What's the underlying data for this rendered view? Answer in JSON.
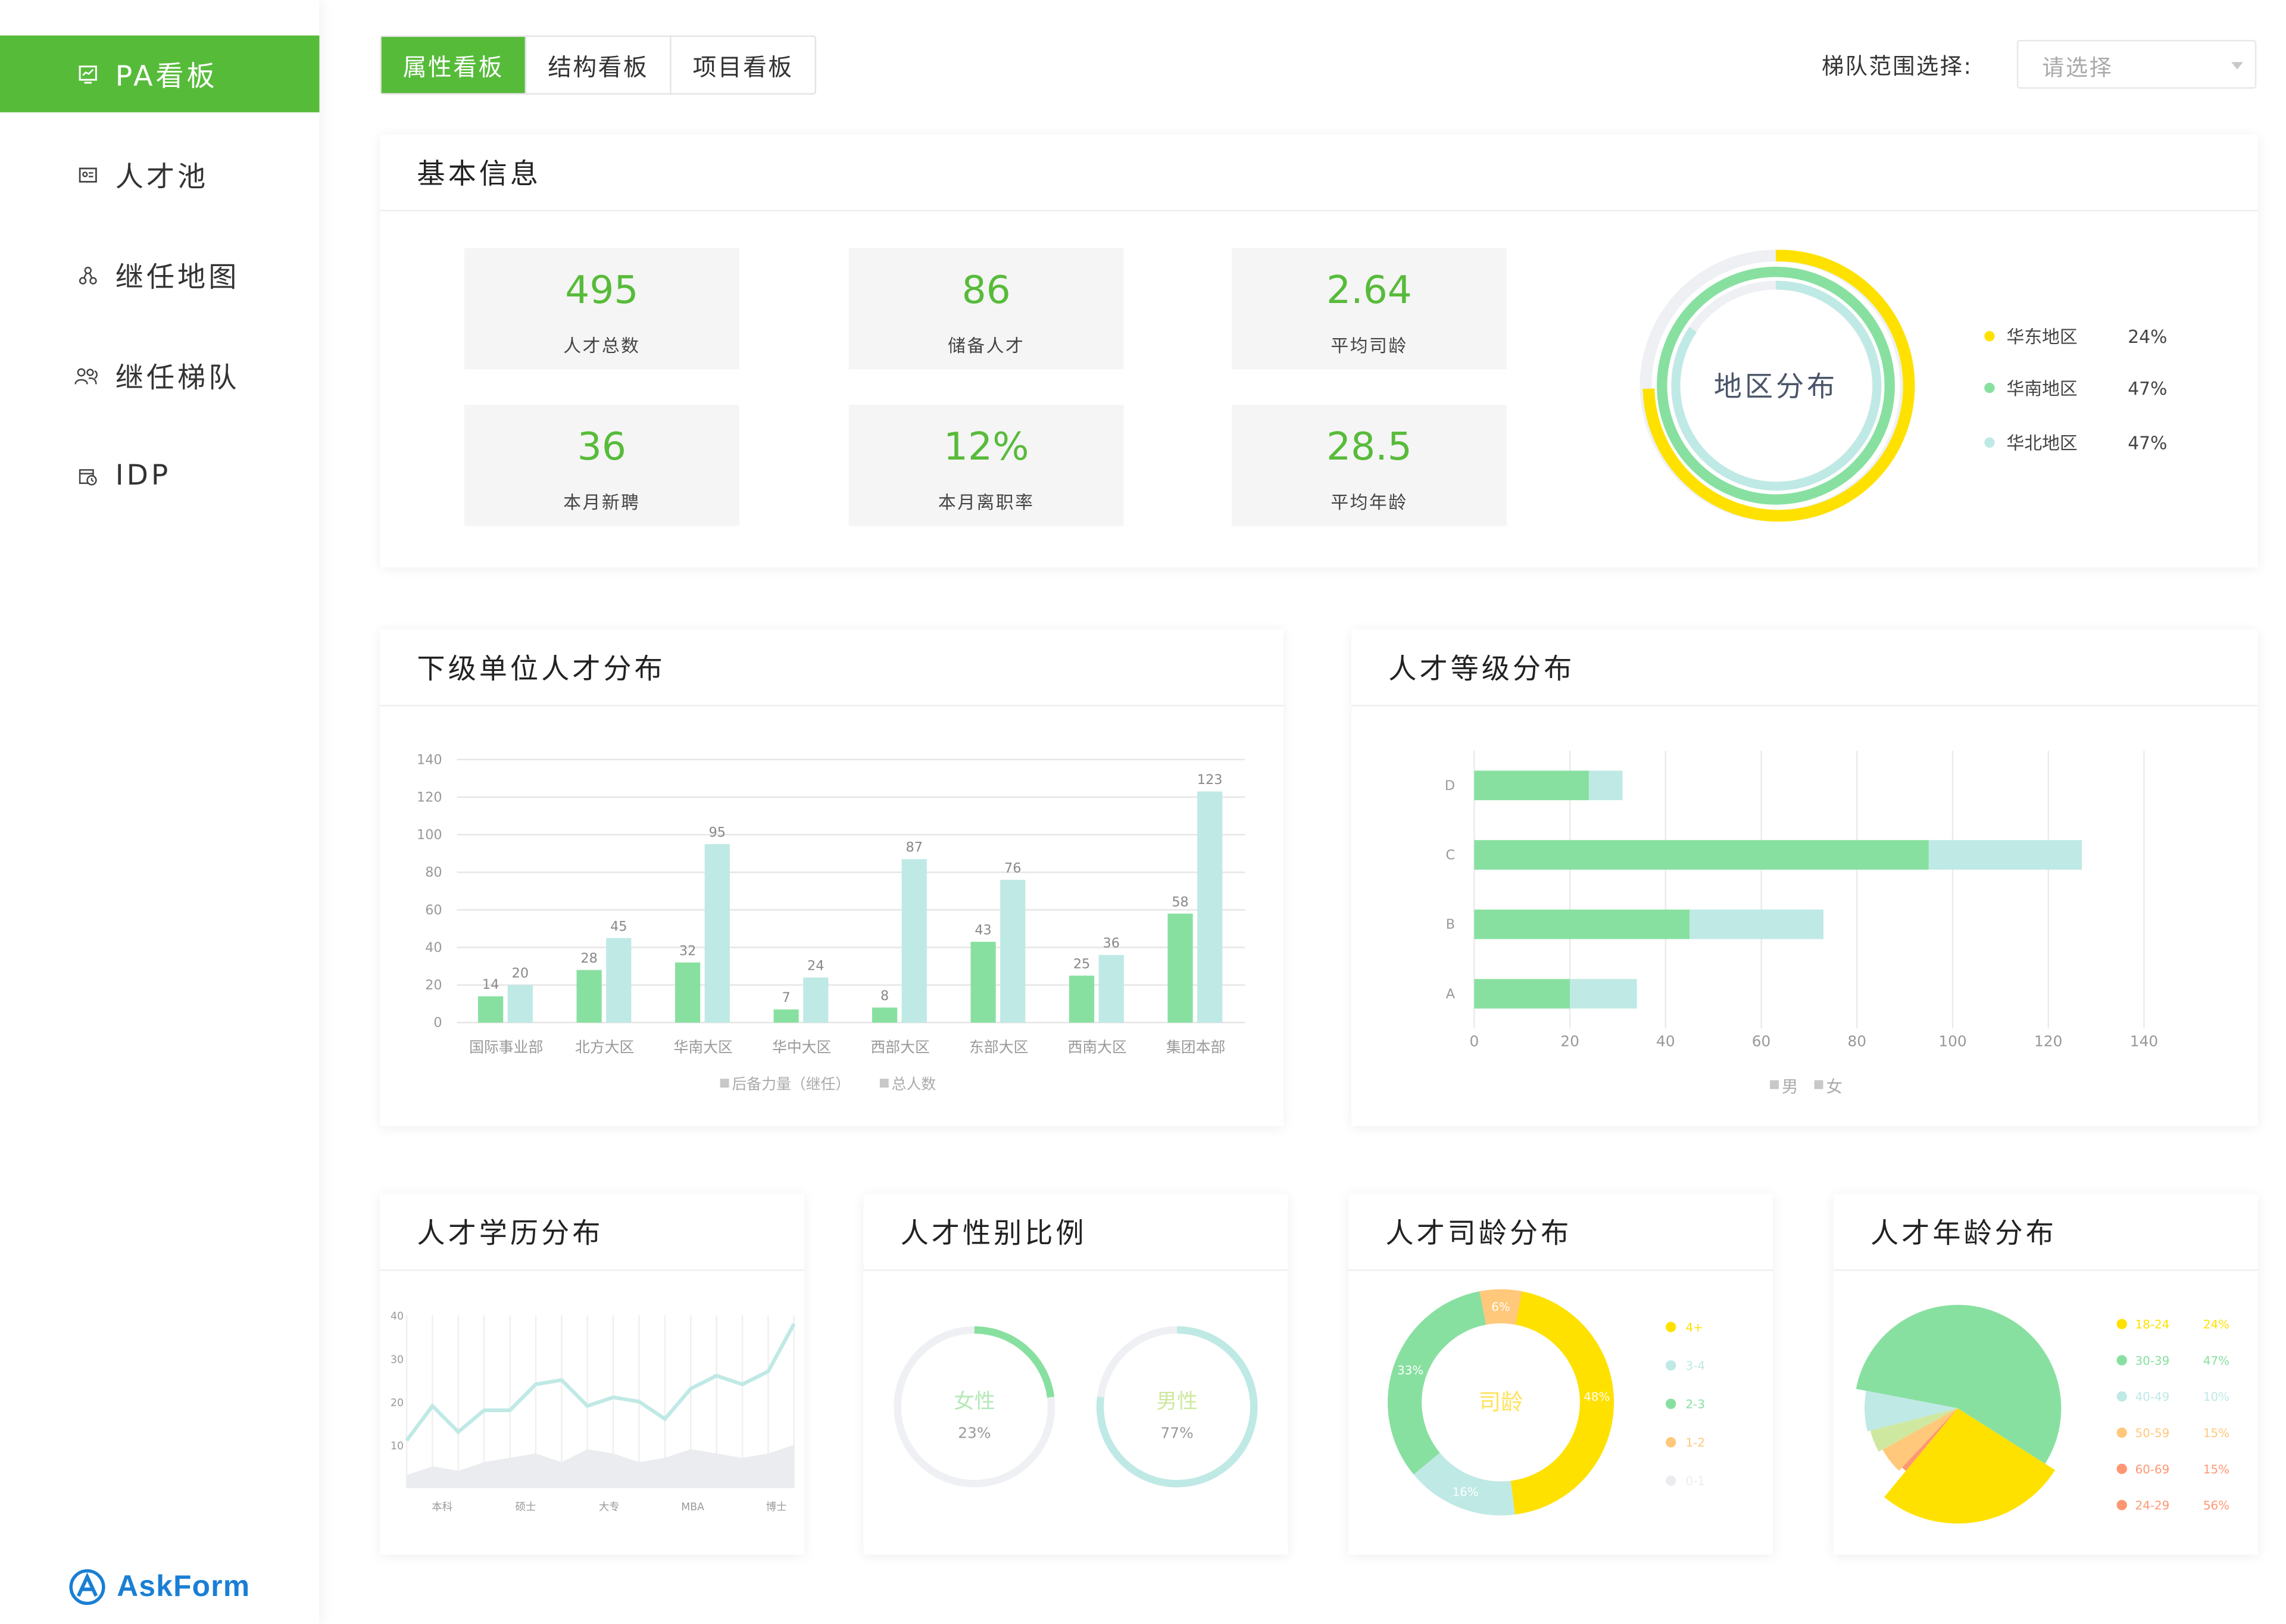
{
  "sidebar": {
    "items": [
      {
        "label": "PA看板",
        "icon": "chart-board-icon"
      },
      {
        "label": "人才池",
        "icon": "id-card-icon"
      },
      {
        "label": "继任地图",
        "icon": "org-map-icon"
      },
      {
        "label": "继任梯队",
        "icon": "team-icon"
      },
      {
        "label": "IDP",
        "icon": "calendar-clock-icon"
      }
    ],
    "logo_text": "AskForm"
  },
  "tabs": [
    {
      "label": "属性看板",
      "active": true
    },
    {
      "label": "结构看板",
      "active": false
    },
    {
      "label": "项目看板",
      "active": false
    }
  ],
  "range": {
    "label": "梯队范围选择:",
    "placeholder": "请选择"
  },
  "basic": {
    "title": "基本信息",
    "kpis": [
      {
        "value": "495",
        "label": "人才总数"
      },
      {
        "value": "86",
        "label": "储备人才"
      },
      {
        "value": "2.64",
        "label": "平均司龄"
      },
      {
        "value": "36",
        "label": "本月新聘"
      },
      {
        "value": "12%",
        "label": "本月离职率"
      },
      {
        "value": "28.5",
        "label": "平均年龄"
      }
    ],
    "region": {
      "center_label": "地区分布",
      "items": [
        {
          "name": "华东地区",
          "pct": "24%",
          "color": "#ffe100"
        },
        {
          "name": "华南地区",
          "pct": "47%",
          "color": "#88e0a0"
        },
        {
          "name": "华北地区",
          "pct": "47%",
          "color": "#bfe9e5"
        }
      ]
    }
  },
  "units": {
    "title": "下级单位人才分布"
  },
  "levels": {
    "title": "人才等级分布"
  },
  "education": {
    "title": "人才学历分布"
  },
  "gender": {
    "title": "人才性别比例",
    "female": {
      "label": "女性",
      "pct": "23%"
    },
    "male": {
      "label": "男性",
      "pct": "77%"
    }
  },
  "tenure": {
    "title": "人才司龄分布",
    "center_label": "司龄"
  },
  "age": {
    "title": "人才年龄分布"
  },
  "colors": {
    "accent": "#57bb3a",
    "green": "#88e0a0",
    "teal": "#bfe9e5",
    "yellow": "#ffe100",
    "orange": "#ffc87a",
    "salmon": "#ff9673"
  },
  "chart_data": [
    {
      "id": "units",
      "type": "bar",
      "categories": [
        "国际事业部",
        "北方大区",
        "华南大区",
        "华中大区",
        "西部大区",
        "东部大区",
        "西南大区",
        "集团本部"
      ],
      "series": [
        {
          "name": "后备力量（继任）",
          "values": [
            14,
            28,
            32,
            7,
            8,
            43,
            25,
            58
          ],
          "color": "#88e0a0"
        },
        {
          "name": "总人数",
          "values": [
            20,
            45,
            95,
            24,
            87,
            76,
            36,
            123
          ],
          "color": "#bfe9e5"
        }
      ],
      "ylim": [
        0,
        140
      ],
      "yticks": [
        0,
        20,
        40,
        60,
        80,
        100,
        120,
        140
      ],
      "legend": "bottom"
    },
    {
      "id": "levels",
      "type": "bar",
      "orientation": "horizontal",
      "stacked": true,
      "categories": [
        "A",
        "B",
        "C",
        "D"
      ],
      "series": [
        {
          "name": "男",
          "values": [
            20,
            45,
            95,
            24
          ],
          "color": "#88e0a0"
        },
        {
          "name": "女",
          "values": [
            14,
            28,
            32,
            7
          ],
          "color": "#bfe9e5"
        }
      ],
      "xlim": [
        0,
        140
      ],
      "xticks": [
        0,
        20,
        40,
        60,
        80,
        100,
        120,
        140
      ],
      "legend": "bottom"
    },
    {
      "id": "education",
      "type": "line",
      "categories": [
        "本科",
        "硕士",
        "大专",
        "MBA",
        "博士"
      ],
      "yticks": [
        10,
        20,
        30,
        40
      ],
      "ylim": [
        0,
        40
      ],
      "series": [
        {
          "name": "line",
          "values": [
            11,
            19,
            13,
            18,
            18,
            24,
            25,
            19,
            21,
            20,
            16,
            23,
            26,
            24,
            27,
            38
          ],
          "color": "#bfe9e5"
        },
        {
          "name": "area",
          "values": [
            3,
            5,
            4,
            6,
            7,
            8,
            6,
            9,
            8,
            6,
            7,
            9,
            8,
            7,
            8,
            10
          ],
          "color": "#eaecef"
        }
      ],
      "legend": "none"
    },
    {
      "id": "gender",
      "type": "pie",
      "slices": [
        {
          "label": "女性",
          "value": 23,
          "color": "#88e0a0"
        },
        {
          "label": "男性",
          "value": 77,
          "color": "#bfe9e5"
        }
      ]
    },
    {
      "id": "tenure",
      "type": "pie",
      "donut": true,
      "slices": [
        {
          "label": "4+",
          "value": 48,
          "color": "#ffe100"
        },
        {
          "label": "3-4",
          "value": 16,
          "color": "#bfe9e5"
        },
        {
          "label": "2-3",
          "value": 33,
          "color": "#88e0a0"
        },
        {
          "label": "1-2",
          "value": 6,
          "color": "#ffc87a"
        },
        {
          "label": "0-1",
          "value": 0,
          "color": "#eaecef"
        }
      ],
      "legend": "right"
    },
    {
      "id": "age",
      "type": "pie",
      "slices": [
        {
          "label": "18-24",
          "value": 24,
          "color": "#ffe100"
        },
        {
          "label": "30-39",
          "value": 47,
          "color": "#88e0a0"
        },
        {
          "label": "40-49",
          "value": 10,
          "color": "#bfe9e5"
        },
        {
          "label": "50-59",
          "value": 15,
          "color": "#ffc87a"
        },
        {
          "label": "60-69",
          "value": 15,
          "color": "#ff9673"
        },
        {
          "label": "24-29",
          "value": 56,
          "color": "#ff9673"
        }
      ],
      "legend_pcts": [
        "24%",
        "47%",
        "10%",
        "15%",
        "15%",
        "56%"
      ],
      "legend": "right"
    }
  ]
}
